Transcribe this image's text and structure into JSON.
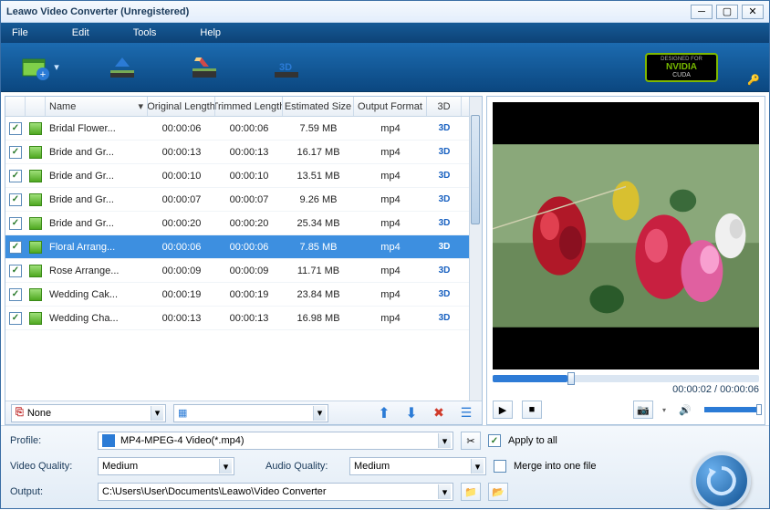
{
  "window": {
    "title": "Leawo Video Converter (Unregistered)"
  },
  "menu": {
    "file": "File",
    "edit": "Edit",
    "tools": "Tools",
    "help": "Help"
  },
  "toolbar": {
    "nvidia_top": "DESIGNED FOR",
    "nvidia_brand": "NVIDIA",
    "nvidia_sub": "CUDA"
  },
  "columns": {
    "name": "Name",
    "orig": "Original Length",
    "trim": "Trimmed Length",
    "est": "Estimated Size",
    "fmt": "Output Format",
    "threeD": "3D"
  },
  "rows": [
    {
      "name": "Bridal Flower...",
      "orig": "00:00:06",
      "trim": "00:00:06",
      "est": "7.59 MB",
      "fmt": "mp4",
      "selected": false
    },
    {
      "name": "Bride and Gr...",
      "orig": "00:00:13",
      "trim": "00:00:13",
      "est": "16.17 MB",
      "fmt": "mp4",
      "selected": false
    },
    {
      "name": "Bride and Gr...",
      "orig": "00:00:10",
      "trim": "00:00:10",
      "est": "13.51 MB",
      "fmt": "mp4",
      "selected": false
    },
    {
      "name": "Bride and Gr...",
      "orig": "00:00:07",
      "trim": "00:00:07",
      "est": "9.26 MB",
      "fmt": "mp4",
      "selected": false
    },
    {
      "name": "Bride and Gr...",
      "orig": "00:00:20",
      "trim": "00:00:20",
      "est": "25.34 MB",
      "fmt": "mp4",
      "selected": false
    },
    {
      "name": "Floral Arrang...",
      "orig": "00:00:06",
      "trim": "00:00:06",
      "est": "7.85 MB",
      "fmt": "mp4",
      "selected": true
    },
    {
      "name": "Rose Arrange...",
      "orig": "00:00:09",
      "trim": "00:00:09",
      "est": "11.71 MB",
      "fmt": "mp4",
      "selected": false
    },
    {
      "name": "Wedding Cak...",
      "orig": "00:00:19",
      "trim": "00:00:19",
      "est": "23.84 MB",
      "fmt": "mp4",
      "selected": false
    },
    {
      "name": "Wedding Cha...",
      "orig": "00:00:13",
      "trim": "00:00:13",
      "est": "16.98 MB",
      "fmt": "mp4",
      "selected": false
    }
  ],
  "listbar": {
    "subtitle": "None"
  },
  "preview": {
    "time_current": "00:00:02",
    "time_total": "00:00:06",
    "sep": " / "
  },
  "bottom": {
    "profile_label": "Profile:",
    "profile_value": "MP4-MPEG-4 Video(*.mp4)",
    "apply_all": "Apply to all",
    "vq_label": "Video Quality:",
    "vq_value": "Medium",
    "aq_label": "Audio Quality:",
    "aq_value": "Medium",
    "merge": "Merge into one file",
    "output_label": "Output:",
    "output_value": "C:\\Users\\User\\Documents\\Leawo\\Video Converter"
  }
}
